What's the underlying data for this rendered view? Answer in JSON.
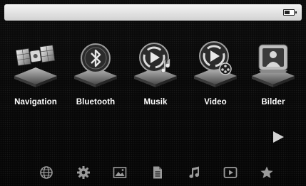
{
  "status_bar": {
    "battery_level": 0.6,
    "battery_icon": "battery-icon"
  },
  "main_menu": {
    "items": [
      {
        "label": "Navigation",
        "icon": "satellite-icon"
      },
      {
        "label": "Bluetooth",
        "icon": "bluetooth-icon"
      },
      {
        "label": "Musik",
        "icon": "music-disc-icon"
      },
      {
        "label": "Video",
        "icon": "video-disc-icon"
      },
      {
        "label": "Bilder",
        "icon": "picture-frame-icon"
      }
    ],
    "next_page_icon": "play-arrow-icon"
  },
  "dock": {
    "items": [
      {
        "icon": "globe-icon"
      },
      {
        "icon": "gear-icon"
      },
      {
        "icon": "image-icon"
      },
      {
        "icon": "document-icon"
      },
      {
        "icon": "music-note-icon"
      },
      {
        "icon": "play-screen-icon"
      },
      {
        "icon": "star-icon"
      }
    ]
  },
  "colors": {
    "background": "#000000",
    "status_bar": "#e6e6e6",
    "icon_gray": "#9a9a9a",
    "label_text": "#ffffff"
  }
}
